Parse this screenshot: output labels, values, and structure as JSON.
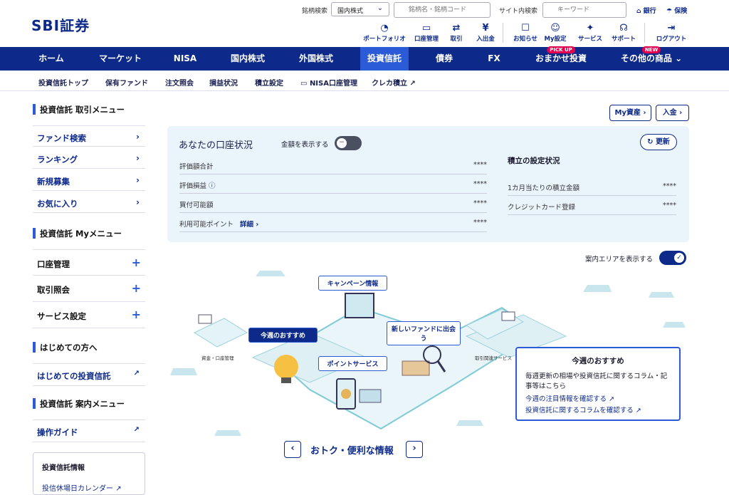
{
  "header": {
    "logo": "SBI証券",
    "stock_search_label": "銘柄検索",
    "market_select": "国内株式",
    "stock_search_placeholder": "銘柄名・銘柄コード",
    "site_search_label": "サイト内検索",
    "site_search_placeholder": "キーワード",
    "bank_label": "銀行",
    "insurance_label": "保険",
    "toolbar": [
      {
        "label": "ポートフォリオ",
        "icon": "pie-chart-icon"
      },
      {
        "label": "口座管理",
        "icon": "card-icon"
      },
      {
        "label": "取引",
        "icon": "exchange-icon"
      },
      {
        "label": "入出金",
        "icon": "yen-icon"
      },
      {
        "label": "お知らせ",
        "icon": "message-icon"
      },
      {
        "label": "My設定",
        "icon": "user-icon"
      },
      {
        "label": "サービス",
        "icon": "service-icon"
      },
      {
        "label": "サポート",
        "icon": "headset-icon"
      },
      {
        "label": "ログアウト",
        "icon": "logout-icon"
      }
    ]
  },
  "nav": {
    "items": [
      {
        "label": "ホーム"
      },
      {
        "label": "マーケット"
      },
      {
        "label": "NISA"
      },
      {
        "label": "国内株式"
      },
      {
        "label": "外国株式"
      },
      {
        "label": "投資信託"
      },
      {
        "label": "債券"
      },
      {
        "label": "FX"
      },
      {
        "label": "おまかせ投資",
        "tag": "PICK UP"
      },
      {
        "label": "その他の商品",
        "tag": "NEW"
      }
    ]
  },
  "subnav": [
    "投資信託トップ",
    "保有ファンド",
    "注文照会",
    "損益状況",
    "積立設定",
    "NISA口座管理",
    "クレカ積立"
  ],
  "sidebar": {
    "trade_menu_title": "投資信託 取引メニュー",
    "trade_items": [
      "ファンド検索",
      "ランキング",
      "新規募集",
      "お気に入り"
    ],
    "my_menu_title": "投資信託 Myメニュー",
    "my_items": [
      "口座管理",
      "取引照会",
      "サービス設定"
    ],
    "beginner_title": "はじめての方へ",
    "beginner_item": "はじめての投資信託",
    "guide_title": "投資信託 案内メニュー",
    "guide_item": "操作ガイド",
    "info_title": "投資信託情報",
    "info_item": "投信休場日カレンダー"
  },
  "actions": {
    "my_assets": "My資産",
    "deposit": "入金"
  },
  "account": {
    "title": "あなたの口座状況",
    "show_amount_label": "金額を表示する",
    "refresh_label": "更新",
    "rows": [
      {
        "label": "評価額合計",
        "value": "****"
      },
      {
        "label": "評価損益",
        "value": "****"
      },
      {
        "label": "買付可能額",
        "value": "****"
      },
      {
        "label": "利用可能ポイント",
        "value": "****",
        "link": "詳細"
      }
    ],
    "reserve_title": "積立の設定状況",
    "reserve_rows": [
      {
        "label": "1カ月当たりの積立金額",
        "value": "****"
      },
      {
        "label": "クレジットカード登録",
        "value": "****"
      }
    ]
  },
  "guide_toggle_label": "案内エリアを表示する",
  "illustration": {
    "campaign": "キャンペーン情報",
    "weekly": "今週のおすすめ",
    "new_fund": "新しいファンドに出会う",
    "points": "ポイントサービス",
    "funds_label": "資金・口座管理",
    "related_label": "取引関連サービス"
  },
  "recommend": {
    "title": "今週のおすすめ",
    "desc": "毎週更新の相場や投資信託に関するコラム・記事等はこちら",
    "link1": "今週の注目情報を確認する",
    "link2": "投資信託に関するコラムを確認する"
  },
  "carousel_title": "おトク・便利な情報",
  "colors": {
    "primary": "#0d2a8a",
    "accent": "#2b5bd7",
    "panel": "#eaf4fb",
    "tag": "#e5004f"
  }
}
